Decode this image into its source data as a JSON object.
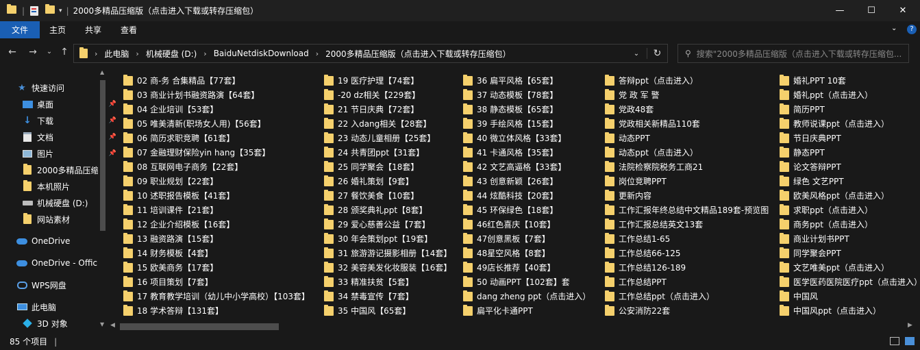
{
  "window": {
    "title": "2000多精品压缩版（点击进入下载或转存压缩包）",
    "minimize_label": "—",
    "maximize_label": "☐",
    "close_label": "✕"
  },
  "ribbon": {
    "tabs": [
      "文件",
      "主页",
      "共享",
      "查看"
    ]
  },
  "address": {
    "crumbs": [
      "此电脑",
      "机械硬盘 (D:)",
      "BaiduNetdiskDownload",
      "2000多精品压缩版（点击进入下载或转存压缩包）"
    ],
    "search_placeholder": "搜索\"2000多精品压缩版（点击进入下载或转存压缩包..."
  },
  "sidebar": {
    "items": [
      {
        "label": "快速访问",
        "icon": "star-icon",
        "pinned": false
      },
      {
        "label": "桌面",
        "icon": "desktop-icon",
        "pinned": true
      },
      {
        "label": "下载",
        "icon": "download-icon",
        "pinned": true
      },
      {
        "label": "文档",
        "icon": "document-icon",
        "pinned": true
      },
      {
        "label": "图片",
        "icon": "picture-icon",
        "pinned": true
      },
      {
        "label": "2000多精品压缩",
        "icon": "folder-icon",
        "pinned": false
      },
      {
        "label": "本机照片",
        "icon": "folder-icon",
        "pinned": false
      },
      {
        "label": "机械硬盘 (D:)",
        "icon": "drive-icon",
        "pinned": false
      },
      {
        "label": "网站素材",
        "icon": "folder-icon",
        "pinned": false
      },
      {
        "label": "OneDrive",
        "icon": "cloud-icon",
        "pinned": false
      },
      {
        "label": "OneDrive - Offic",
        "icon": "cloud-icon",
        "pinned": false
      },
      {
        "label": "WPS网盘",
        "icon": "wps-cloud-icon",
        "pinned": false
      },
      {
        "label": "此电脑",
        "icon": "computer-icon",
        "pinned": false
      },
      {
        "label": "3D 对象",
        "icon": "cube-icon",
        "pinned": false
      }
    ]
  },
  "files": {
    "columns": [
      [
        "02 商-务 合集精品【77套】",
        "03 商业计划书融资路演【64套】",
        "04 企业培训【53套】",
        "05 唯美清新(职场女人用)【56套】",
        "06 简历求职竞聘【61套】",
        "07 金融理财保险yin hang【35套】",
        "08 互联网电子商务【22套】",
        "09 职业规划【22套】",
        "10 述职报告模板【41套】",
        "11 培训课件【21套】",
        "12 企业介绍模板【16套】",
        "13 融资路演【15套】",
        "14 财务模板【4套】",
        "15 欧美商务【17套】",
        "16 项目策划【7套】",
        "17 教育教学培训（幼儿中小学高校）【103套】",
        "18 学术答辩【131套】"
      ],
      [
        "19 医疗护理【74套】",
        "-20 dz相关【229套】",
        "21 节日庆典【72套】",
        "22 入dang相关【28套】",
        "23 动态儿童相册【25套】",
        "24 共青团ppt【31套】",
        "25 同学聚会【18套】",
        "26 婚礼策划【9套】",
        "27 餐饮美食【10套】",
        "28 颁奖典礼ppt【8套】",
        "29 爱心慈善公益【7套】",
        "30 年会策划ppt【19套】",
        "31 旅游游记摄影相册【14套】",
        "32 美容美发化妆服装【16套】",
        "33 精准扶贫【5套】",
        "34 禁毒宣传【7套】",
        "35 中国风【65套】"
      ],
      [
        "36 扁平风格【65套】",
        "37 动态模板【78套】",
        "38 静态模板【65套】",
        "39 手绘风格【15套】",
        "40 微立体风格【33套】",
        "41 卡通风格【35套】",
        "42 文艺高逼格【33套】",
        "43 创意新颖【26套】",
        "44 炫酷科技【20套】",
        "45 环保绿色【18套】",
        "46红色喜庆【10套】",
        "47创意黑板【7套】",
        "48星空风格【8套】",
        "49店长推荐【40套】",
        "50 动画PPT【102套】套",
        "dang zheng  ppt（点击进入）",
        "扁平化卡通PPT"
      ],
      [
        "答辩ppt（点击进入）",
        "党 政 军 警",
        "党政48套",
        "党政相关新精品110套",
        "动态PPT",
        "动态ppt（点击进入）",
        "法院检察院税务工商21",
        "岗位竞聘PPT",
        "更新内容",
        "工作汇报年终总结中文精品189套-预览图",
        "工作汇报总结英文13套",
        "工作总结1-65",
        "工作总结66-125",
        "工作总结126-189",
        "工作总结PPT",
        "工作总结ppt（点击进入）",
        "公安消防22套"
      ],
      [
        "婚礼PPT 10套",
        "婚礼ppt（点击进入）",
        "简历PPT",
        "教师说课ppt（点击进入）",
        "节日庆典PPT",
        "静态PPT",
        "论文答辩PPT",
        "绿色 文艺PPT",
        "欧美风格ppt（点击进入）",
        "求职ppt（点击进入）",
        "商务ppt（点击进入）",
        "商业计划书PPT",
        "同学聚会PPT",
        "文艺唯美ppt（点击进入）",
        "医学医药医院医疗ppt（点击进入）",
        "中国风",
        "中国风ppt（点击进入）"
      ]
    ]
  },
  "status": {
    "item_count": "85 个项目"
  },
  "colors": {
    "folder": "#f5d06c",
    "file_tab": "#1a5fb4",
    "background": "#191919"
  }
}
